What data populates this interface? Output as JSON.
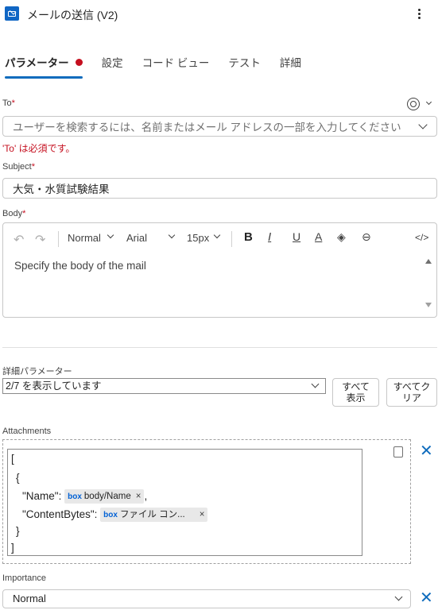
{
  "header": {
    "title": "メールの送信 (V2)",
    "app_icon": "outlook-mail-icon",
    "more_icon": "more-vertical-icon"
  },
  "tabs": [
    {
      "label": "パラメーター",
      "active": true,
      "has_error": true
    },
    {
      "label": "設定",
      "active": false
    },
    {
      "label": "コード ビュー",
      "active": false
    },
    {
      "label": "テスト",
      "active": false
    },
    {
      "label": "詳細",
      "active": false
    }
  ],
  "to": {
    "label": "To",
    "required_mark": "*",
    "placeholder": "ユーザーを検索するには、名前またはメール アドレスの一部を入力してください",
    "error": "'To' は必須です。"
  },
  "subject": {
    "label": "Subject",
    "required_mark": "*",
    "value": "大気・水質試験結果"
  },
  "body": {
    "label": "Body",
    "required_mark": "*",
    "toolbar": {
      "style": "Normal",
      "font": "Arial",
      "size": "15px",
      "bold": "B",
      "italic": "I",
      "underline": "U",
      "font_color": "A"
    },
    "placeholder": "Specify the body of the mail"
  },
  "advanced": {
    "label": "詳細パラメーター",
    "select_value": "2/7 を表示しています",
    "show_all_line1": "すべて",
    "show_all_line2": "表示",
    "clear_all_line1": "すべてク",
    "clear_all_line2": "リア"
  },
  "attachments": {
    "label": "Attachments",
    "open_bracket": "[",
    "open_brace": "{",
    "name_key": "\"Name\":",
    "name_token_prefix": "box",
    "name_token": "body/Name",
    "name_suffix": ",",
    "content_key": "\"ContentBytes\":",
    "content_token_prefix": "box",
    "content_token": "ファイル コン...",
    "close_brace": "}",
    "close_bracket": "]",
    "token_close": "×",
    "remove": "✕"
  },
  "importance": {
    "label": "Importance",
    "value": "Normal",
    "remove": "✕"
  },
  "colors": {
    "accent": "#0f6cbd",
    "error": "#c50f1f",
    "box_brand": "#0061d5"
  }
}
